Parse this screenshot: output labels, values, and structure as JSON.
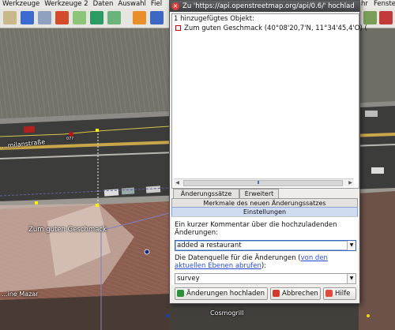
{
  "menubar": {
    "items": [
      "Werkzeuge",
      "Werkzeuge 2",
      "Daten",
      "Auswahl",
      "Fiel",
      "hr",
      "Fenster"
    ]
  },
  "map": {
    "labels": {
      "street_left": "...milanstraße",
      "restaurant": "Zum guten Geschmack",
      "bottom_left": "...ine Mazar",
      "bottom_center": "Cosmogrill",
      "marker_small": "07?"
    }
  },
  "dialog": {
    "title": "Zu 'https://api.openstreetmap.org/api/0.6/' hochlad",
    "added_header": "1 hinzugefügtes Objekt:",
    "added_object": "Zum guten Geschmack (40°08'20,7'N, 11°34'45,4'O) (",
    "tabs_row1": [
      "Änderungssätze",
      "Erweitert"
    ],
    "tabs_row2": "Merkmale des neuen Änderungssatzes",
    "tabs_row3": "Einstellungen",
    "comment_label_line1": "Ein kurzer Kommentar über die hochzuladenden",
    "comment_label_line2": "Änderungen:",
    "comment_value": "added a restaurant",
    "source_label_prefix": "Die Datenquelle für die Änderungen (",
    "source_link_line1": "von den",
    "source_link_line2": "aktuellen Ebenen abrufen",
    "source_label_suffix": "):",
    "source_value": "survey",
    "buttons": {
      "upload": "Änderungen hochladen",
      "cancel": "Abbrechen",
      "help": "Hilfe"
    }
  },
  "colors": {
    "accent": "#3a66b6",
    "link": "#2a4bd3",
    "cancel_icon": "#d23b2b",
    "upload_icon": "#2f8f3a"
  }
}
